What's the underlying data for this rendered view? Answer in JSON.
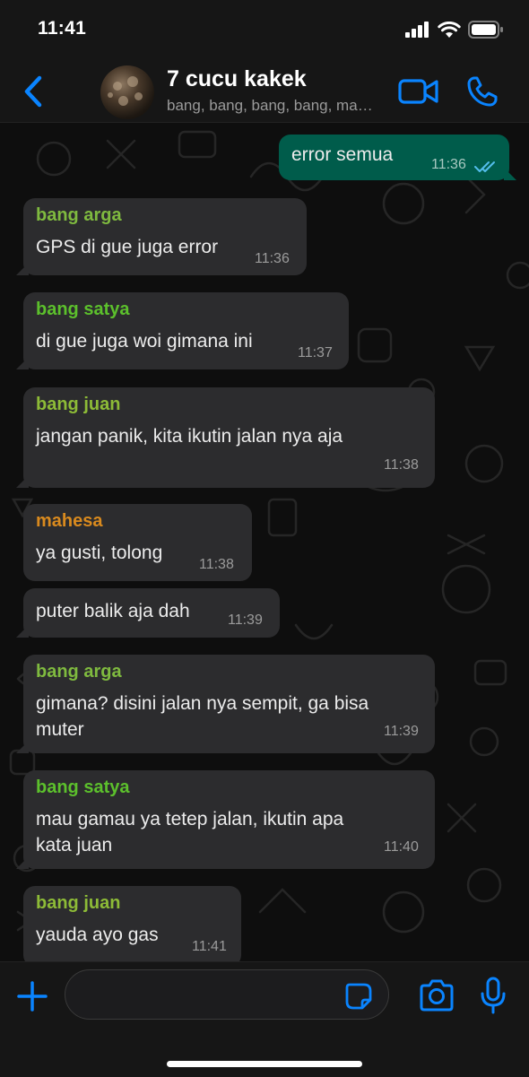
{
  "status_bar": {
    "time": "11:41"
  },
  "header": {
    "title": "7 cucu kakek",
    "subtitle": "bang, bang, bang, bang, mahesa, You"
  },
  "messages": [
    {
      "direction": "out",
      "sender": "",
      "text": "error semua",
      "time": "11:36",
      "status_icon": "double-check-read-icon"
    },
    {
      "direction": "in",
      "sender": "bang arga",
      "sender_color": "#7fba3f",
      "text": "GPS di gue juga error",
      "time": "11:36"
    },
    {
      "direction": "in",
      "sender": "bang satya",
      "sender_color": "#5cc02c",
      "text": "di gue juga woi gimana ini",
      "time": "11:37"
    },
    {
      "direction": "in",
      "sender": "bang juan",
      "sender_color": "#8dbb37",
      "text": "jangan panik, kita ikutin jalan nya aja",
      "time": "11:38"
    },
    {
      "direction": "in",
      "sender": "mahesa",
      "sender_color": "#d98a1e",
      "text": "ya gusti, tolong",
      "time": "11:38"
    },
    {
      "direction": "in",
      "sender": "",
      "text": "puter balik aja dah",
      "time": "11:39"
    },
    {
      "direction": "in",
      "sender": "bang arga",
      "sender_color": "#7fba3f",
      "text_lines": [
        "gimana? disini jalan nya sempit, ga bisa",
        "muter"
      ],
      "time": "11:39"
    },
    {
      "direction": "in",
      "sender": "bang satya",
      "sender_color": "#5cc02c",
      "text_lines": [
        "mau gamau ya tetep jalan, ikutin apa",
        "kata juan"
      ],
      "time": "11:40"
    },
    {
      "direction": "in",
      "sender": "bang juan",
      "sender_color": "#8dbb37",
      "text": "yauda ayo gas",
      "time": "11:41"
    }
  ],
  "composer": {
    "input_value": ""
  },
  "colors": {
    "accent": "#0a84ff",
    "outgoing_bubble": "#005c4b",
    "incoming_bubble": "#2c2c2e",
    "read_ticks": "#53bdeb"
  }
}
